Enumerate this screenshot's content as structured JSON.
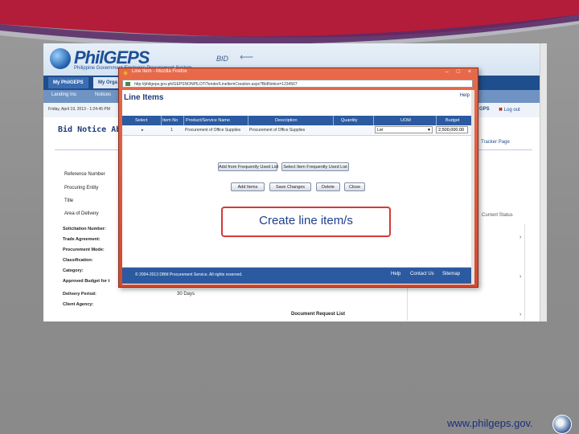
{
  "site": {
    "logo_text": "PhilGEPS",
    "logo_subtitle": "Philippine Government Electronic Procurement System",
    "bid_label": "BID"
  },
  "nav": {
    "tabs": [
      "My PhilGEPS",
      "My Orga"
    ],
    "subnav": [
      "Landing Ins",
      "Notices",
      "Supplier"
    ],
    "date_text": "Friday, April 19, 2013 - 1:24:45 PM",
    "lgps_label": "GPS",
    "logout_label": "Log out"
  },
  "page": {
    "title": "Bid Notice Abs",
    "tracker_label": "Tracker Page",
    "fields": [
      "Reference Number",
      "Procuring Entity",
      "Title",
      "Area of Delivery"
    ],
    "fields2": [
      "Solicitation Number:",
      "Trade Agreement:",
      "Procurement Mode:",
      "Classification:",
      "Category:",
      "Approved Budget for t",
      "Delivery Period:",
      "Client Agency:"
    ],
    "delivery_value": "30 Days",
    "right_note": "Current Status",
    "doc_request": "Document Request List"
  },
  "popup": {
    "window_title": "Line Item - Mozilla Firefox",
    "window_controls": "– □ ×",
    "url": "http://philgeps.gov.ph/GEPSNONPILOT/Tender/LineItemCreation.aspx?BidNotice=1234567",
    "heading": "Line Items",
    "help": "Help",
    "columns": [
      "Select",
      "Item No",
      "Product/Service Name",
      "Description",
      "Quantity",
      "UOM",
      "Budget"
    ],
    "row": {
      "select": "",
      "item_no": "1",
      "product": "Procurement of Office Supplies",
      "description": "Procurement of Office Supplies",
      "quantity": "",
      "uom": "Lot",
      "budget": "2,500,000.00"
    },
    "buttons_row1": [
      "Add from Frequently Used List",
      "Select Item Frequently Used List"
    ],
    "buttons_row2": [
      "Add Items",
      "Save Changes",
      "Delete",
      "Close"
    ],
    "copyright": "© 2004-2013 DBM Procurement Service. All rights reserved.",
    "footer_links": [
      "Help",
      "Contact Us",
      "Sitemap"
    ]
  },
  "callout": {
    "text": "Create line item/s"
  },
  "footer": {
    "url_text": "www.philgeps.gov."
  },
  "colors": {
    "popup_frame": "#d24a2e",
    "header_blue": "#2b5aa0",
    "callout_border": "#d43a3a",
    "callout_text": "#1f3d8a"
  }
}
